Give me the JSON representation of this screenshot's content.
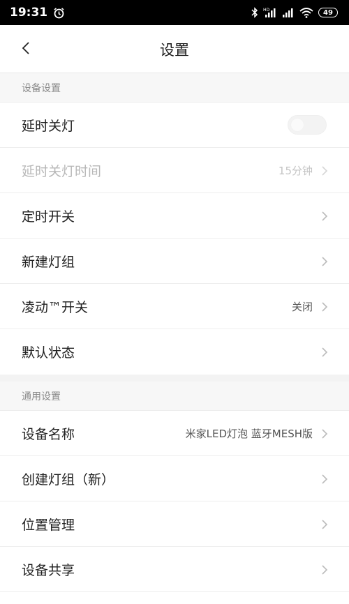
{
  "status_bar": {
    "time": "19:31",
    "battery": "49",
    "icons": [
      "alarm-icon",
      "bluetooth-icon",
      "hd-signal-icon",
      "signal-icon",
      "wifi-icon",
      "battery-icon"
    ]
  },
  "header": {
    "title": "设置",
    "back_icon": "chevron-left-icon"
  },
  "sections": {
    "device": {
      "title": "设备设置",
      "items": [
        {
          "label": "延时关灯",
          "control": "toggle",
          "toggle_on": false
        },
        {
          "label": "延时关灯时间",
          "value": "15分钟",
          "disabled": true
        },
        {
          "label": "定时开关"
        },
        {
          "label": "新建灯组"
        },
        {
          "label": "凌动™开关",
          "value": "关闭"
        },
        {
          "label": "默认状态"
        }
      ]
    },
    "general": {
      "title": "通用设置",
      "items": [
        {
          "label": "设备名称",
          "value": "米家LED灯泡 蓝牙MESH版"
        },
        {
          "label": "创建灯组（新）"
        },
        {
          "label": "位置管理"
        },
        {
          "label": "设备共享"
        }
      ]
    }
  },
  "colors": {
    "status_bar_bg": "#000000",
    "section_bg": "#f7f7f7",
    "disabled_text": "#b8b8b8",
    "chevron": "#bbbbbb"
  }
}
